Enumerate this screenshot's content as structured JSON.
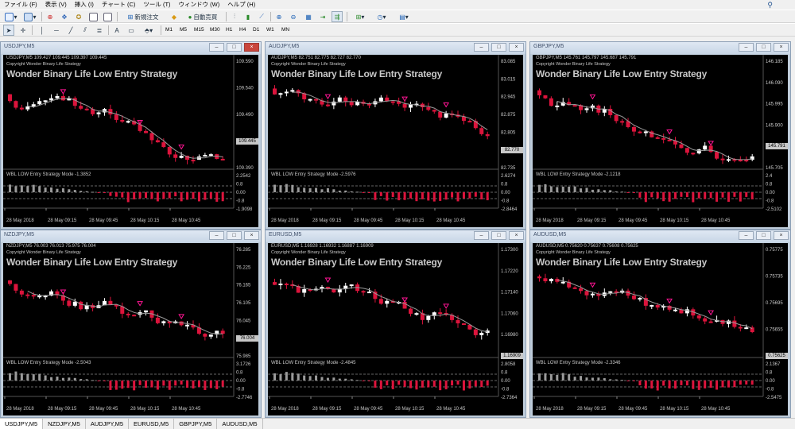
{
  "menu": {
    "items": [
      "ファイル (F)",
      "表示 (V)",
      "挿入 (I)",
      "チャート (C)",
      "ツール (T)",
      "ウィンドウ (W)",
      "ヘルプ (H)"
    ]
  },
  "toolbar": {
    "new_order_label": "新規注文",
    "auto_trading_label": "自動売買"
  },
  "timeframes": [
    "M1",
    "M5",
    "M15",
    "M30",
    "H1",
    "H4",
    "D1",
    "W1",
    "MN"
  ],
  "colors": {
    "bull_candle": "#ffffff",
    "bear_candle": "#dc143c",
    "ma_line": "#9a9a9a",
    "signal_arrow": "#ff1493",
    "title_active_close": "#c9463d"
  },
  "strategy_name": "Wonder Binary Life Low Entry Strategy",
  "copyright": "Copyright Wonder Binary Life Strategy",
  "charts": [
    {
      "title": "USDJPY,M5",
      "ohlc": "USDJPY,M5  109.427 109.445 109.397 109.445",
      "price_ticks": [
        "109.590",
        "109.540",
        "109.490",
        "109.445",
        "109.390"
      ],
      "current_price": "109.445",
      "indicator_label": "WBL LOW Entry Strategy Mode -1.3852",
      "indicator_ticks": [
        "2.2542",
        "0.8",
        "0.00",
        "-0.8",
        "-1.9098"
      ],
      "time_labels": [
        "28 May 2018",
        "28 May 09:15",
        "28 May 09:45",
        "28 May 10:15",
        "28 May 10:45"
      ]
    },
    {
      "title": "AUDJPY,M5",
      "ohlc": "AUDJPY,M5  82.751 82.775 82.727 82.770",
      "price_ticks": [
        "83.085",
        "83.015",
        "82.945",
        "82.875",
        "82.805",
        "82.770",
        "82.735"
      ],
      "current_price": "82.770",
      "indicator_label": "WBL LOW Entry Strategy Mode -2.5976",
      "indicator_ticks": [
        "2.6274",
        "0.8",
        "0.00",
        "-0.8",
        "-2.8464"
      ],
      "time_labels": [
        "28 May 2018",
        "28 May 09:15",
        "28 May 09:45",
        "28 May 10:15",
        "28 May 10:45"
      ]
    },
    {
      "title": "GBPJPY,M5",
      "ohlc": "GBPJPY,M5  145.761 145.797 145.687 145.791",
      "price_ticks": [
        "146.185",
        "146.090",
        "145.995",
        "145.900",
        "145.791",
        "145.705"
      ],
      "current_price": "145.791",
      "indicator_label": "WBL LOW Entry Strategy Mode -2.1218",
      "indicator_ticks": [
        "2.4",
        "0.8",
        "0.00",
        "-0.8",
        "-2.5102"
      ],
      "time_labels": [
        "28 May 2018",
        "28 May 09:15",
        "28 May 09:45",
        "28 May 10:15",
        "28 May 10:45"
      ]
    },
    {
      "title": "NZDJPY,M5",
      "ohlc": "NZDJPY,M5  76.003 76.013 75.975 76.004",
      "price_ticks": [
        "76.285",
        "76.225",
        "76.165",
        "76.105",
        "76.045",
        "76.004",
        "75.985"
      ],
      "current_price": "76.004",
      "indicator_label": "WBL LOW Entry Strategy Mode -2.5043",
      "indicator_ticks": [
        "3.1726",
        "0.8",
        "0.00",
        "-0.8",
        "-2.7746"
      ],
      "time_labels": [
        "28 May 2018",
        "28 May 09:15",
        "28 May 09:45",
        "28 May 10:15",
        "28 May 10:45"
      ]
    },
    {
      "title": "EURUSD,M5",
      "ohlc": "EURUSD,M5  1.16928 1.16932 1.16887 1.16909",
      "price_ticks": [
        "1.17300",
        "1.17220",
        "1.17140",
        "1.17060",
        "1.16980",
        "1.16909"
      ],
      "current_price": "1.16909",
      "indicator_label": "WBL LOW Entry Strategy Mode -2.4845",
      "indicator_ticks": [
        "2.8058",
        "0.8",
        "0.00",
        "-0.8",
        "-2.7364"
      ],
      "time_labels": [
        "28 May 2018",
        "28 May 09:15",
        "28 May 09:45",
        "28 May 10:15",
        "28 May 10:45"
      ]
    },
    {
      "title": "AUDUSD,M5",
      "ohlc": "AUDUSD,M5  0.75620 0.75637 0.75608 0.75625",
      "price_ticks": [
        "0.75775",
        "0.75735",
        "0.75695",
        "0.75655",
        "0.75625"
      ],
      "current_price": "0.75625",
      "indicator_label": "WBL LOW Entry Strategy Mode -2.3346",
      "indicator_ticks": [
        "2.1367",
        "0.8",
        "0.00",
        "-0.8",
        "-2.5475"
      ],
      "time_labels": [
        "28 May 2018",
        "28 May 09:15",
        "28 May 09:45",
        "28 May 10:15",
        "28 May 10:45"
      ]
    }
  ],
  "tabs": [
    "USDJPY,M5",
    "NZDJPY,M5",
    "AUDJPY,M5",
    "EURUSD,M5",
    "GBPJPY,M5",
    "AUDUSD,M5"
  ]
}
